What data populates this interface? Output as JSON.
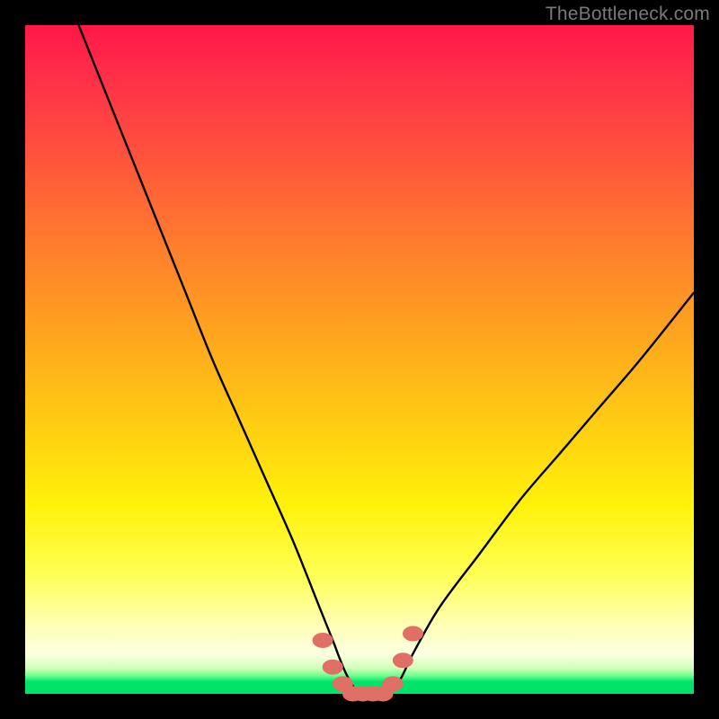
{
  "watermark": "TheBottleneck.com",
  "chart_data": {
    "type": "line",
    "title": "",
    "xlabel": "",
    "ylabel": "",
    "xlim": [
      0,
      100
    ],
    "ylim": [
      0,
      100
    ],
    "grid": false,
    "legend": false,
    "notes": "Axes are unlabeled; values are approximate normalized percentages read from the plot shape. Curve resembles a V with vertex near x≈50 at y≈0 (bottom = good / green band). Left arm rises to ~100% at x≈8; right arm rises to ~60% at x=100.",
    "series": [
      {
        "name": "bottleneck-curve",
        "x": [
          8,
          12,
          16,
          20,
          24,
          28,
          32,
          36,
          40,
          44,
          46,
          48,
          50,
          52,
          54,
          56,
          58,
          62,
          68,
          74,
          80,
          86,
          92,
          100
        ],
        "y": [
          100,
          90,
          80,
          70,
          60,
          50,
          41,
          32,
          23,
          13,
          8,
          3,
          0,
          0,
          0,
          2,
          6,
          13,
          21,
          29,
          36,
          43,
          50,
          60
        ]
      }
    ],
    "markers": {
      "name": "highlight-dots",
      "color": "#e07066",
      "x": [
        44.5,
        46,
        47.5,
        49,
        50.5,
        52,
        53.5,
        55,
        56.5,
        58
      ],
      "y": [
        8,
        4,
        1.5,
        0,
        0,
        0,
        0,
        1.5,
        5,
        9
      ]
    },
    "background_gradient": {
      "top": "#ff1748",
      "mid": "#ffd400",
      "bottom": "#00e36b"
    }
  }
}
